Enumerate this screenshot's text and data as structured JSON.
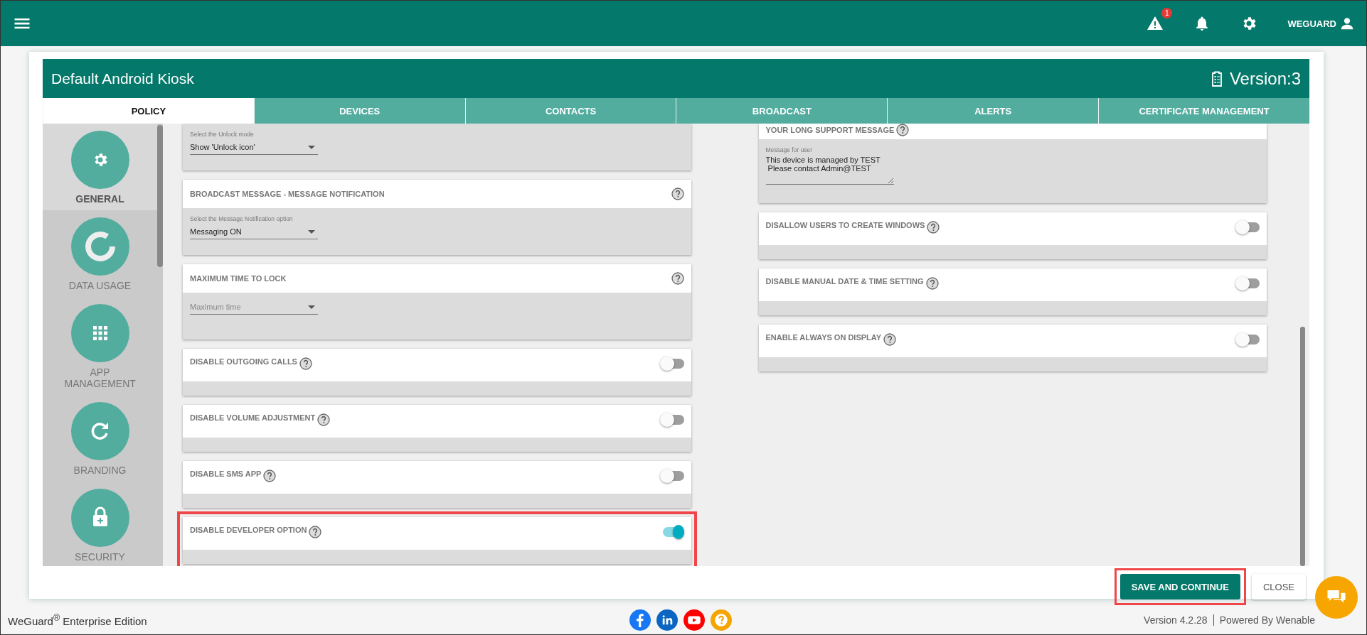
{
  "topbar": {
    "alert_count": "1",
    "user": "WEGUARD"
  },
  "header": {
    "title": "Default Android Kiosk",
    "version": "Version:3"
  },
  "tabs": [
    {
      "label": "POLICY",
      "selected": true
    },
    {
      "label": "DEVICES",
      "selected": false
    },
    {
      "label": "CONTACTS",
      "selected": false
    },
    {
      "label": "BROADCAST",
      "selected": false
    },
    {
      "label": "ALERTS",
      "selected": false
    },
    {
      "label": "CERTIFICATE MANAGEMENT",
      "selected": false
    }
  ],
  "sidebar": {
    "items": [
      {
        "kind": "gear",
        "label": "GENERAL",
        "selected": true
      },
      {
        "kind": "donut",
        "label": "DATA USAGE",
        "selected": false
      },
      {
        "kind": "grid",
        "label": "APP MANAGEMENT",
        "selected": false
      },
      {
        "kind": "refresh",
        "label": "BRANDING",
        "selected": false
      },
      {
        "kind": "lock",
        "label": "SECURITY",
        "selected": false
      }
    ]
  },
  "left_cards": [
    {
      "kind": "select",
      "field_label": "Select the Unlock mode",
      "value": "Show 'Unlock icon'"
    },
    {
      "kind": "select",
      "title": "BROADCAST MESSAGE - MESSAGE NOTIFICATION",
      "field_label": "Select the Message Notification option",
      "value": "Messaging ON"
    },
    {
      "kind": "select",
      "title": "MAXIMUM TIME TO LOCK",
      "placeholder": "Maximum time"
    },
    {
      "kind": "toggle",
      "title": "DISABLE OUTGOING CALLS",
      "on": false,
      "highlighted": false
    },
    {
      "kind": "toggle",
      "title": "DISABLE VOLUME ADJUSTMENT",
      "on": false,
      "highlighted": false
    },
    {
      "kind": "toggle",
      "title": "DISABLE SMS APP",
      "on": false,
      "highlighted": false
    },
    {
      "kind": "toggle",
      "title": "DISABLE DEVELOPER OPTION",
      "on": true,
      "highlighted": true
    }
  ],
  "right_cards": [
    {
      "kind": "textarea",
      "title": "YOUR LONG SUPPORT MESSAGE",
      "field_label": "Message for user",
      "value": "This device is managed by TEST\n Please contact Admin@TEST"
    },
    {
      "kind": "toggle",
      "title": "DISALLOW USERS TO CREATE WINDOWS",
      "on": false,
      "highlighted": false
    },
    {
      "kind": "toggle",
      "title": "DISABLE MANUAL DATE & TIME SETTING",
      "on": false,
      "highlighted": false
    },
    {
      "kind": "toggle",
      "title": "ENABLE ALWAYS ON DISPLAY",
      "on": false,
      "highlighted": false
    }
  ],
  "actions": [
    {
      "kind": "primary",
      "label": "SAVE AND CONTINUE",
      "highlighted": true
    },
    {
      "kind": "secondary",
      "label": "CLOSE",
      "highlighted": false
    }
  ],
  "footer": {
    "edition": "WeGuard$^{®}$ Enterprise Edition",
    "version": "Version 4.2.28",
    "powered": "Powered By Wenable"
  }
}
